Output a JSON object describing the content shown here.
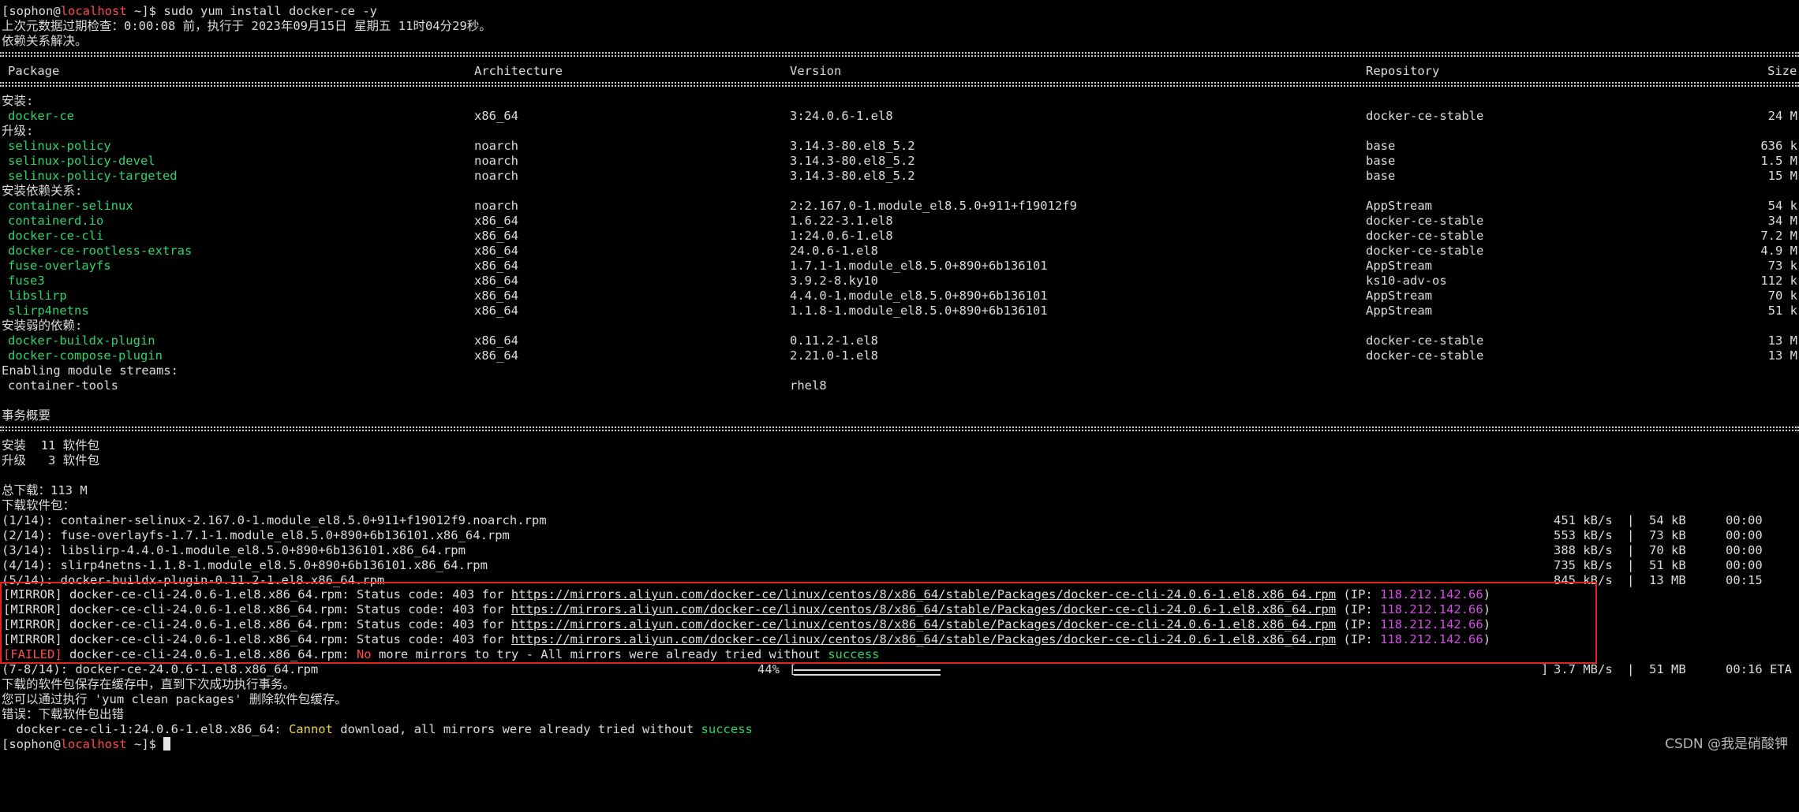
{
  "prompt": {
    "user": "sophon",
    "at": "@",
    "host": "localhost",
    "path": " ~]$ ",
    "open": "[",
    "command": "sudo yum install docker-ce -y"
  },
  "meta_line": "上次元数据过期检查：0:00:08 前，执行于 2023年09月15日 星期五 11时04分29秒。",
  "deps_resolved": "依赖关系解决。",
  "columns": {
    "package": "Package",
    "arch": "Architecture",
    "version": "Version",
    "repo": "Repository",
    "size": "Size"
  },
  "groups": [
    {
      "label": "安装:",
      "rows": [
        {
          "package": "docker-ce",
          "arch": "x86_64",
          "version": "3:24.0.6-1.el8",
          "repo": "docker-ce-stable",
          "size": "24 M"
        }
      ]
    },
    {
      "label": "升级:",
      "rows": [
        {
          "package": "selinux-policy",
          "arch": "noarch",
          "version": "3.14.3-80.el8_5.2",
          "repo": "base",
          "size": "636 k"
        },
        {
          "package": "selinux-policy-devel",
          "arch": "noarch",
          "version": "3.14.3-80.el8_5.2",
          "repo": "base",
          "size": "1.5 M"
        },
        {
          "package": "selinux-policy-targeted",
          "arch": "noarch",
          "version": "3.14.3-80.el8_5.2",
          "repo": "base",
          "size": "15 M"
        }
      ]
    },
    {
      "label": "安装依赖关系:",
      "rows": [
        {
          "package": "container-selinux",
          "arch": "noarch",
          "version": "2:2.167.0-1.module_el8.5.0+911+f19012f9",
          "repo": "AppStream",
          "size": "54 k"
        },
        {
          "package": "containerd.io",
          "arch": "x86_64",
          "version": "1.6.22-3.1.el8",
          "repo": "docker-ce-stable",
          "size": "34 M"
        },
        {
          "package": "docker-ce-cli",
          "arch": "x86_64",
          "version": "1:24.0.6-1.el8",
          "repo": "docker-ce-stable",
          "size": "7.2 M"
        },
        {
          "package": "docker-ce-rootless-extras",
          "arch": "x86_64",
          "version": "24.0.6-1.el8",
          "repo": "docker-ce-stable",
          "size": "4.9 M"
        },
        {
          "package": "fuse-overlayfs",
          "arch": "x86_64",
          "version": "1.7.1-1.module_el8.5.0+890+6b136101",
          "repo": "AppStream",
          "size": "73 k"
        },
        {
          "package": "fuse3",
          "arch": "x86_64",
          "version": "3.9.2-8.ky10",
          "repo": "ks10-adv-os",
          "size": "112 k"
        },
        {
          "package": "libslirp",
          "arch": "x86_64",
          "version": "4.4.0-1.module_el8.5.0+890+6b136101",
          "repo": "AppStream",
          "size": "70 k"
        },
        {
          "package": "slirp4netns",
          "arch": "x86_64",
          "version": "1.1.8-1.module_el8.5.0+890+6b136101",
          "repo": "AppStream",
          "size": "51 k"
        }
      ]
    },
    {
      "label": "安装弱的依赖:",
      "rows": [
        {
          "package": "docker-buildx-plugin",
          "arch": "x86_64",
          "version": "0.11.2-1.el8",
          "repo": "docker-ce-stable",
          "size": "13 M"
        },
        {
          "package": "docker-compose-plugin",
          "arch": "x86_64",
          "version": "2.21.0-1.el8",
          "repo": "docker-ce-stable",
          "size": "13 M"
        }
      ]
    }
  ],
  "module": {
    "label": "Enabling module streams:",
    "name": "container-tools",
    "stream": "rhel8"
  },
  "summary": {
    "title": "事务概要",
    "install": "安装  11 软件包",
    "upgrade": "升级   3 软件包",
    "total": "总下载：113 M",
    "downloading": "下载软件包："
  },
  "downloads": [
    {
      "name": "(1/14): container-selinux-2.167.0-1.module_el8.5.0+911+f19012f9.noarch.rpm",
      "speed": "451 kB/s",
      "size": "54 kB",
      "time": "00:00"
    },
    {
      "name": "(2/14): fuse-overlayfs-1.7.1-1.module_el8.5.0+890+6b136101.x86_64.rpm",
      "speed": "553 kB/s",
      "size": "73 kB",
      "time": "00:00"
    },
    {
      "name": "(3/14): libslirp-4.4.0-1.module_el8.5.0+890+6b136101.x86_64.rpm",
      "speed": "388 kB/s",
      "size": "70 kB",
      "time": "00:00"
    },
    {
      "name": "(4/14): slirp4netns-1.1.8-1.module_el8.5.0+890+6b136101.x86_64.rpm",
      "speed": "735 kB/s",
      "size": "51 kB",
      "time": "00:00"
    },
    {
      "name": "(5/14): docker-buildx-plugin-0.11.2-1.el8.x86_64.rpm",
      "speed": "845 kB/s",
      "size": "13 MB",
      "time": "00:15"
    }
  ],
  "sep": "|",
  "mirror_error": {
    "tag": "[MIRROR]",
    "text": " docker-ce-cli-24.0.6-1.el8.x86_64.rpm: Status code: 403 for ",
    "url": "https://mirrors.aliyun.com/docker-ce/linux/centos/8/x86_64/stable/Packages/docker-ce-cli-24.0.6-1.el8.x86_64.rpm",
    "ip_open": " (IP: ",
    "ip": "118.212.142.66",
    "ip_close": ")"
  },
  "failed": {
    "tag": "[FAILED]",
    "text": " docker-ce-cli-24.0.6-1.el8.x86_64.rpm: ",
    "no": "No",
    "rest": " more mirrors to try - All mirrors were already tried without ",
    "success": "success"
  },
  "progress": {
    "name": "(7-8/14): docker-ce-24.0.6-1.el8.x86_64.rpm",
    "percent": "44%",
    "fraction": 0.44,
    "open": "[",
    "close": "]",
    "speed": "3.7 MB/s",
    "size": "51 MB",
    "eta": "00:16 ETA"
  },
  "tail": {
    "cached": "下载的软件包保存在缓存中，直到下次成功执行事务。",
    "clean": "您可以通过执行 'yum clean packages' 删除软件包缓存。",
    "error": "错误：下载软件包出错",
    "detail_pre": "  docker-ce-cli-1:24.0.6-1.el8.x86_64: ",
    "cannot": "Cannot",
    "detail_mid": " download, all mirrors were already tried without ",
    "success": "success"
  },
  "watermark": "CSDN @我是硝酸钾"
}
